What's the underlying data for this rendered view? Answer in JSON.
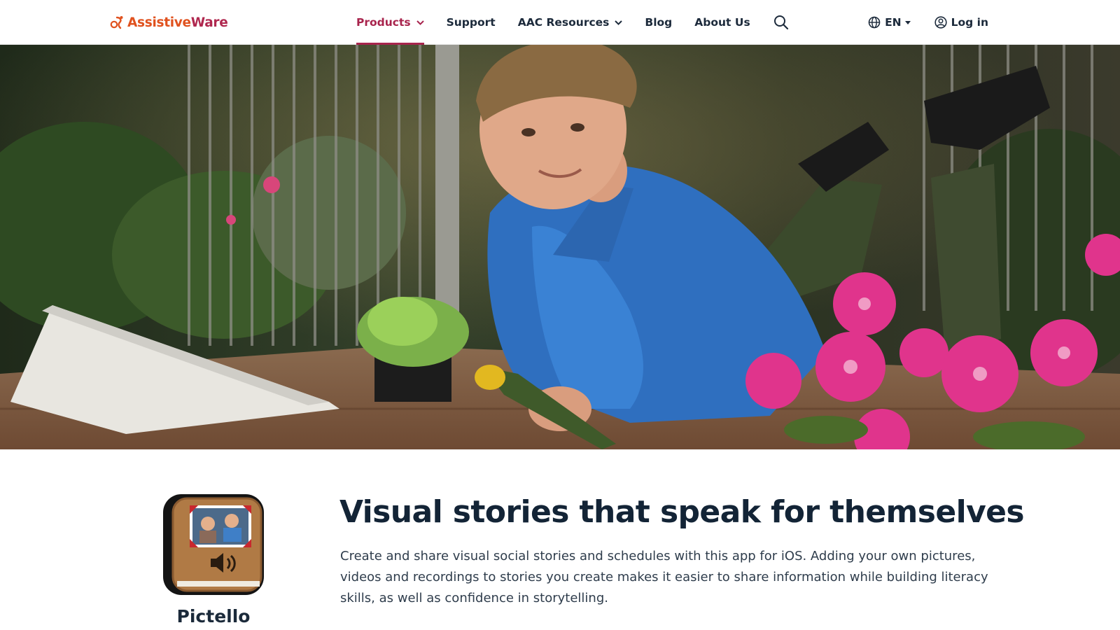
{
  "brand": {
    "name_part1": "Assistive",
    "name_part2": "Ware",
    "primary_color": "#a8244d",
    "accent_color": "#e0521f"
  },
  "nav": {
    "items": [
      {
        "label": "Products",
        "active": true,
        "has_dropdown": true
      },
      {
        "label": "Support",
        "active": false,
        "has_dropdown": false
      },
      {
        "label": "AAC Resources",
        "active": false,
        "has_dropdown": true
      },
      {
        "label": "Blog",
        "active": false,
        "has_dropdown": false
      },
      {
        "label": "About Us",
        "active": false,
        "has_dropdown": false
      }
    ],
    "search_icon": "search-icon"
  },
  "header_right": {
    "language": "EN",
    "language_icon": "globe-icon",
    "login_label": "Log in",
    "login_icon": "user-circle-icon"
  },
  "hero": {
    "image": "hero-photo"
  },
  "product": {
    "app_name": "Pictello",
    "app_icon": "pictello-app-icon",
    "headline": "Visual stories that speak for themselves",
    "description": "Create and share visual social stories and schedules with this app for iOS. Adding your own pictures, videos and recordings to stories you create makes it easier to share information while building literacy skills, as well as confidence in storytelling."
  }
}
